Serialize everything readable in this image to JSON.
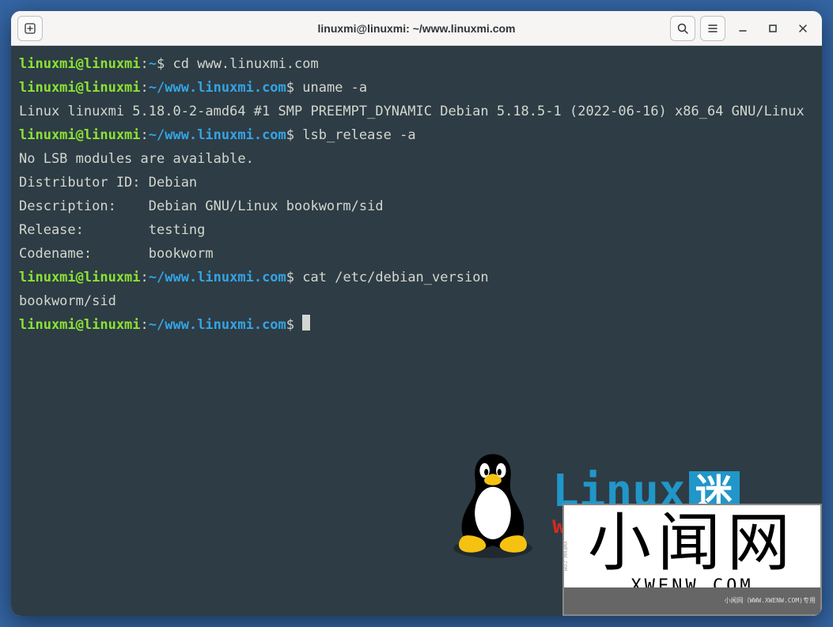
{
  "title": "linuxmi@linuxmi: ~/www.linuxmi.com",
  "prompts": [
    {
      "user": "linuxmi@linuxmi",
      "path": "~",
      "cmd": "cd www.linuxmi.com"
    },
    {
      "user": "linuxmi@linuxmi",
      "path": "~/www.linuxmi.com",
      "cmd": "uname -a"
    },
    {
      "user": "linuxmi@linuxmi",
      "path": "~/www.linuxmi.com",
      "cmd": "lsb_release -a"
    },
    {
      "user": "linuxmi@linuxmi",
      "path": "~/www.linuxmi.com",
      "cmd": "cat /etc/debian_version"
    },
    {
      "user": "linuxmi@linuxmi",
      "path": "~/www.linuxmi.com",
      "cmd": ""
    }
  ],
  "output": {
    "uname": "Linux linuxmi 5.18.0-2-amd64 #1 SMP PREEMPT_DYNAMIC Debian 5.18.5-1 (2022-06-16) x86_64 GNU/Linux",
    "lsb1": "No LSB modules are available.",
    "lsb2": "Distributor ID: Debian",
    "lsb3": "Description:    Debian GNU/Linux bookworm/sid",
    "lsb4": "Release:        testing",
    "lsb5": "Codename:       bookworm",
    "cat": "bookworm/sid"
  },
  "watermark": {
    "linux": "Linux",
    "mi": "迷",
    "url": "www.linuxmi.com",
    "xwen_cn": "小闻网",
    "xwen_en": "XWENW.COM",
    "xwen_foot": "小闻网（WWW.XWENW.COM)专用"
  }
}
